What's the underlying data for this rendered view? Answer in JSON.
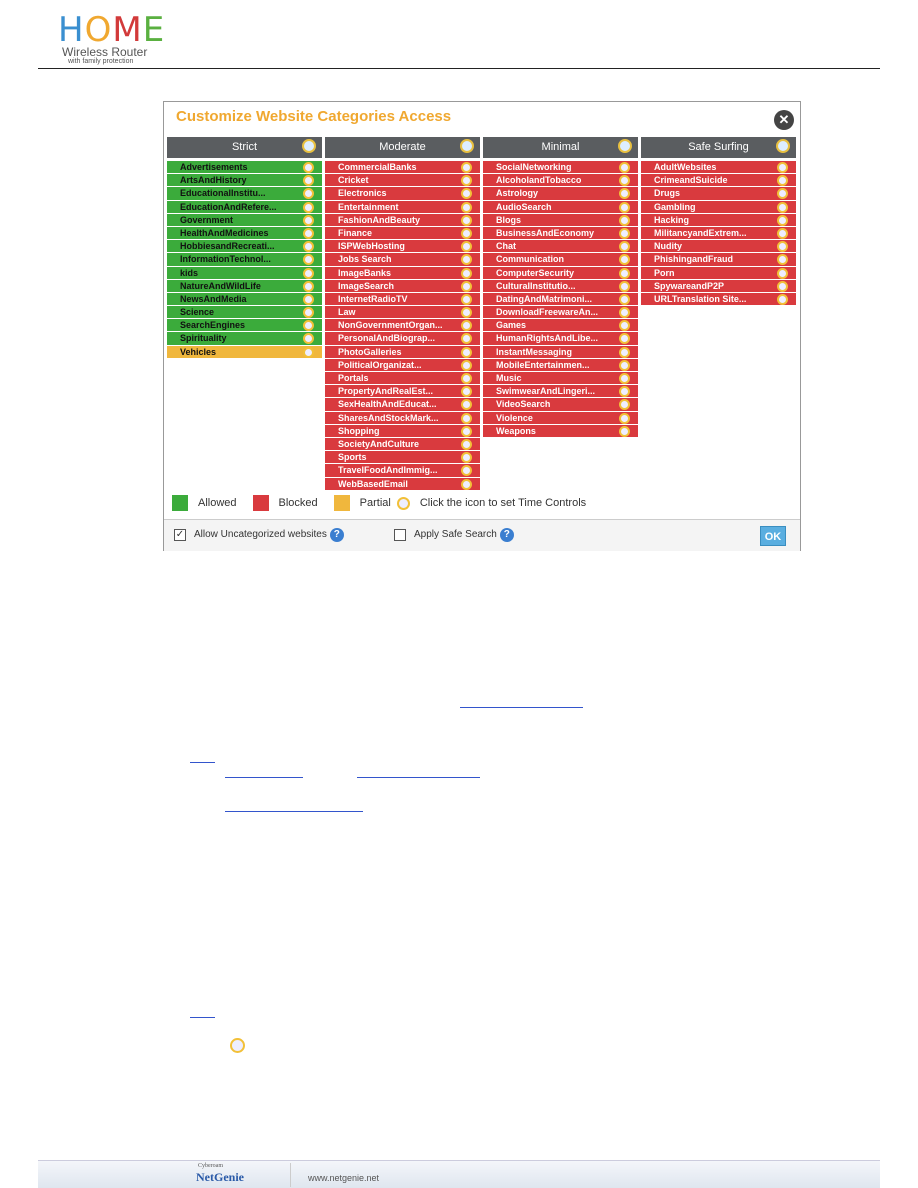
{
  "header": {
    "logo_main": "HOME",
    "logo_sub": "Wireless Router",
    "logo_tag": "with family protection"
  },
  "dialog": {
    "title": "Customize Website Categories Access",
    "close_icon": "close-icon",
    "colors": {
      "allowed": "#3bab3b",
      "blocked": "#d93a3e",
      "partial": "#f0b73d",
      "title": "#f0a830"
    },
    "columns": [
      {
        "name": "Strict",
        "items": [
          [
            "Advertisements",
            "allowed"
          ],
          [
            "ArtsAndHistory",
            "allowed"
          ],
          [
            "EducationalInstitu...",
            "allowed"
          ],
          [
            "EducationAndRefere...",
            "allowed"
          ],
          [
            "Government",
            "allowed"
          ],
          [
            "HealthAndMedicines",
            "allowed"
          ],
          [
            "HobbiesandRecreati...",
            "allowed"
          ],
          [
            "InformationTechnol...",
            "allowed"
          ],
          [
            "kids",
            "allowed"
          ],
          [
            "NatureAndWildLife",
            "allowed"
          ],
          [
            "NewsAndMedia",
            "allowed"
          ],
          [
            "Science",
            "allowed"
          ],
          [
            "SearchEngines",
            "allowed"
          ],
          [
            "Spirituality",
            "allowed"
          ],
          [
            "Vehicles",
            "partial"
          ]
        ]
      },
      {
        "name": "Moderate",
        "items": [
          [
            "CommercialBanks",
            "blocked"
          ],
          [
            "Cricket",
            "blocked"
          ],
          [
            "Electronics",
            "blocked"
          ],
          [
            "Entertainment",
            "blocked"
          ],
          [
            "FashionAndBeauty",
            "blocked"
          ],
          [
            "Finance",
            "blocked"
          ],
          [
            "ISPWebHosting",
            "blocked"
          ],
          [
            "Jobs Search",
            "blocked"
          ],
          [
            "ImageBanks",
            "blocked"
          ],
          [
            "ImageSearch",
            "blocked"
          ],
          [
            "InternetRadioTV",
            "blocked"
          ],
          [
            "Law",
            "blocked"
          ],
          [
            "NonGovernmentOrgan...",
            "blocked"
          ],
          [
            "PersonalAndBiograp...",
            "blocked"
          ],
          [
            "PhotoGalleries",
            "blocked"
          ],
          [
            "PoliticalOrganizat...",
            "blocked"
          ],
          [
            "Portals",
            "blocked"
          ],
          [
            "PropertyAndRealEst...",
            "blocked"
          ],
          [
            "SexHealthAndEducat...",
            "blocked"
          ],
          [
            "SharesAndStockMark...",
            "blocked"
          ],
          [
            "Shopping",
            "blocked"
          ],
          [
            "SocietyAndCulture",
            "blocked"
          ],
          [
            "Sports",
            "blocked"
          ],
          [
            "TravelFoodAndImmig...",
            "blocked"
          ],
          [
            "WebBasedEmail",
            "blocked"
          ]
        ]
      },
      {
        "name": "Minimal",
        "items": [
          [
            "SocialNetworking",
            "blocked"
          ],
          [
            "AlcoholandTobacco",
            "blocked"
          ],
          [
            "Astrology",
            "blocked"
          ],
          [
            "AudioSearch",
            "blocked"
          ],
          [
            "Blogs",
            "blocked"
          ],
          [
            "BusinessAndEconomy",
            "blocked"
          ],
          [
            "Chat",
            "blocked"
          ],
          [
            "Communication",
            "blocked"
          ],
          [
            "ComputerSecurity",
            "blocked"
          ],
          [
            "CulturalInstitutio...",
            "blocked"
          ],
          [
            "DatingAndMatrimoni...",
            "blocked"
          ],
          [
            "DownloadFreewareAn...",
            "blocked"
          ],
          [
            "Games",
            "blocked"
          ],
          [
            "HumanRightsAndLibe...",
            "blocked"
          ],
          [
            "InstantMessaging",
            "blocked"
          ],
          [
            "MobileEntertainmen...",
            "blocked"
          ],
          [
            "Music",
            "blocked"
          ],
          [
            "SwimwearAndLingeri...",
            "blocked"
          ],
          [
            "VideoSearch",
            "blocked"
          ],
          [
            "Violence",
            "blocked"
          ],
          [
            "Weapons",
            "blocked"
          ]
        ]
      },
      {
        "name": "Safe Surfing",
        "items": [
          [
            "AdultWebsites",
            "blocked"
          ],
          [
            "CrimeandSuicide",
            "blocked"
          ],
          [
            "Drugs",
            "blocked"
          ],
          [
            "Gambling",
            "blocked"
          ],
          [
            "Hacking",
            "blocked"
          ],
          [
            "MilitancyandExtrem...",
            "blocked"
          ],
          [
            "Nudity",
            "blocked"
          ],
          [
            "PhishingandFraud",
            "blocked"
          ],
          [
            "Porn",
            "blocked"
          ],
          [
            "SpywareandP2P",
            "blocked"
          ],
          [
            "URLTranslation Site...",
            "blocked"
          ]
        ]
      }
    ],
    "legend": {
      "allowed": "Allowed",
      "blocked": "Blocked",
      "partial": "Partial",
      "time_hint": "Click the icon to set Time Controls"
    },
    "options": {
      "uncategorized_label": "Allow Uncategorized websites",
      "uncategorized_checked": true,
      "safe_search_label": "Apply Safe Search",
      "safe_search_checked": false,
      "help": "?",
      "ok_label": "OK"
    }
  },
  "footer": {
    "brand_top": "Cyberoam",
    "brand": "NetGenie",
    "url": "www.netgenie.net"
  }
}
